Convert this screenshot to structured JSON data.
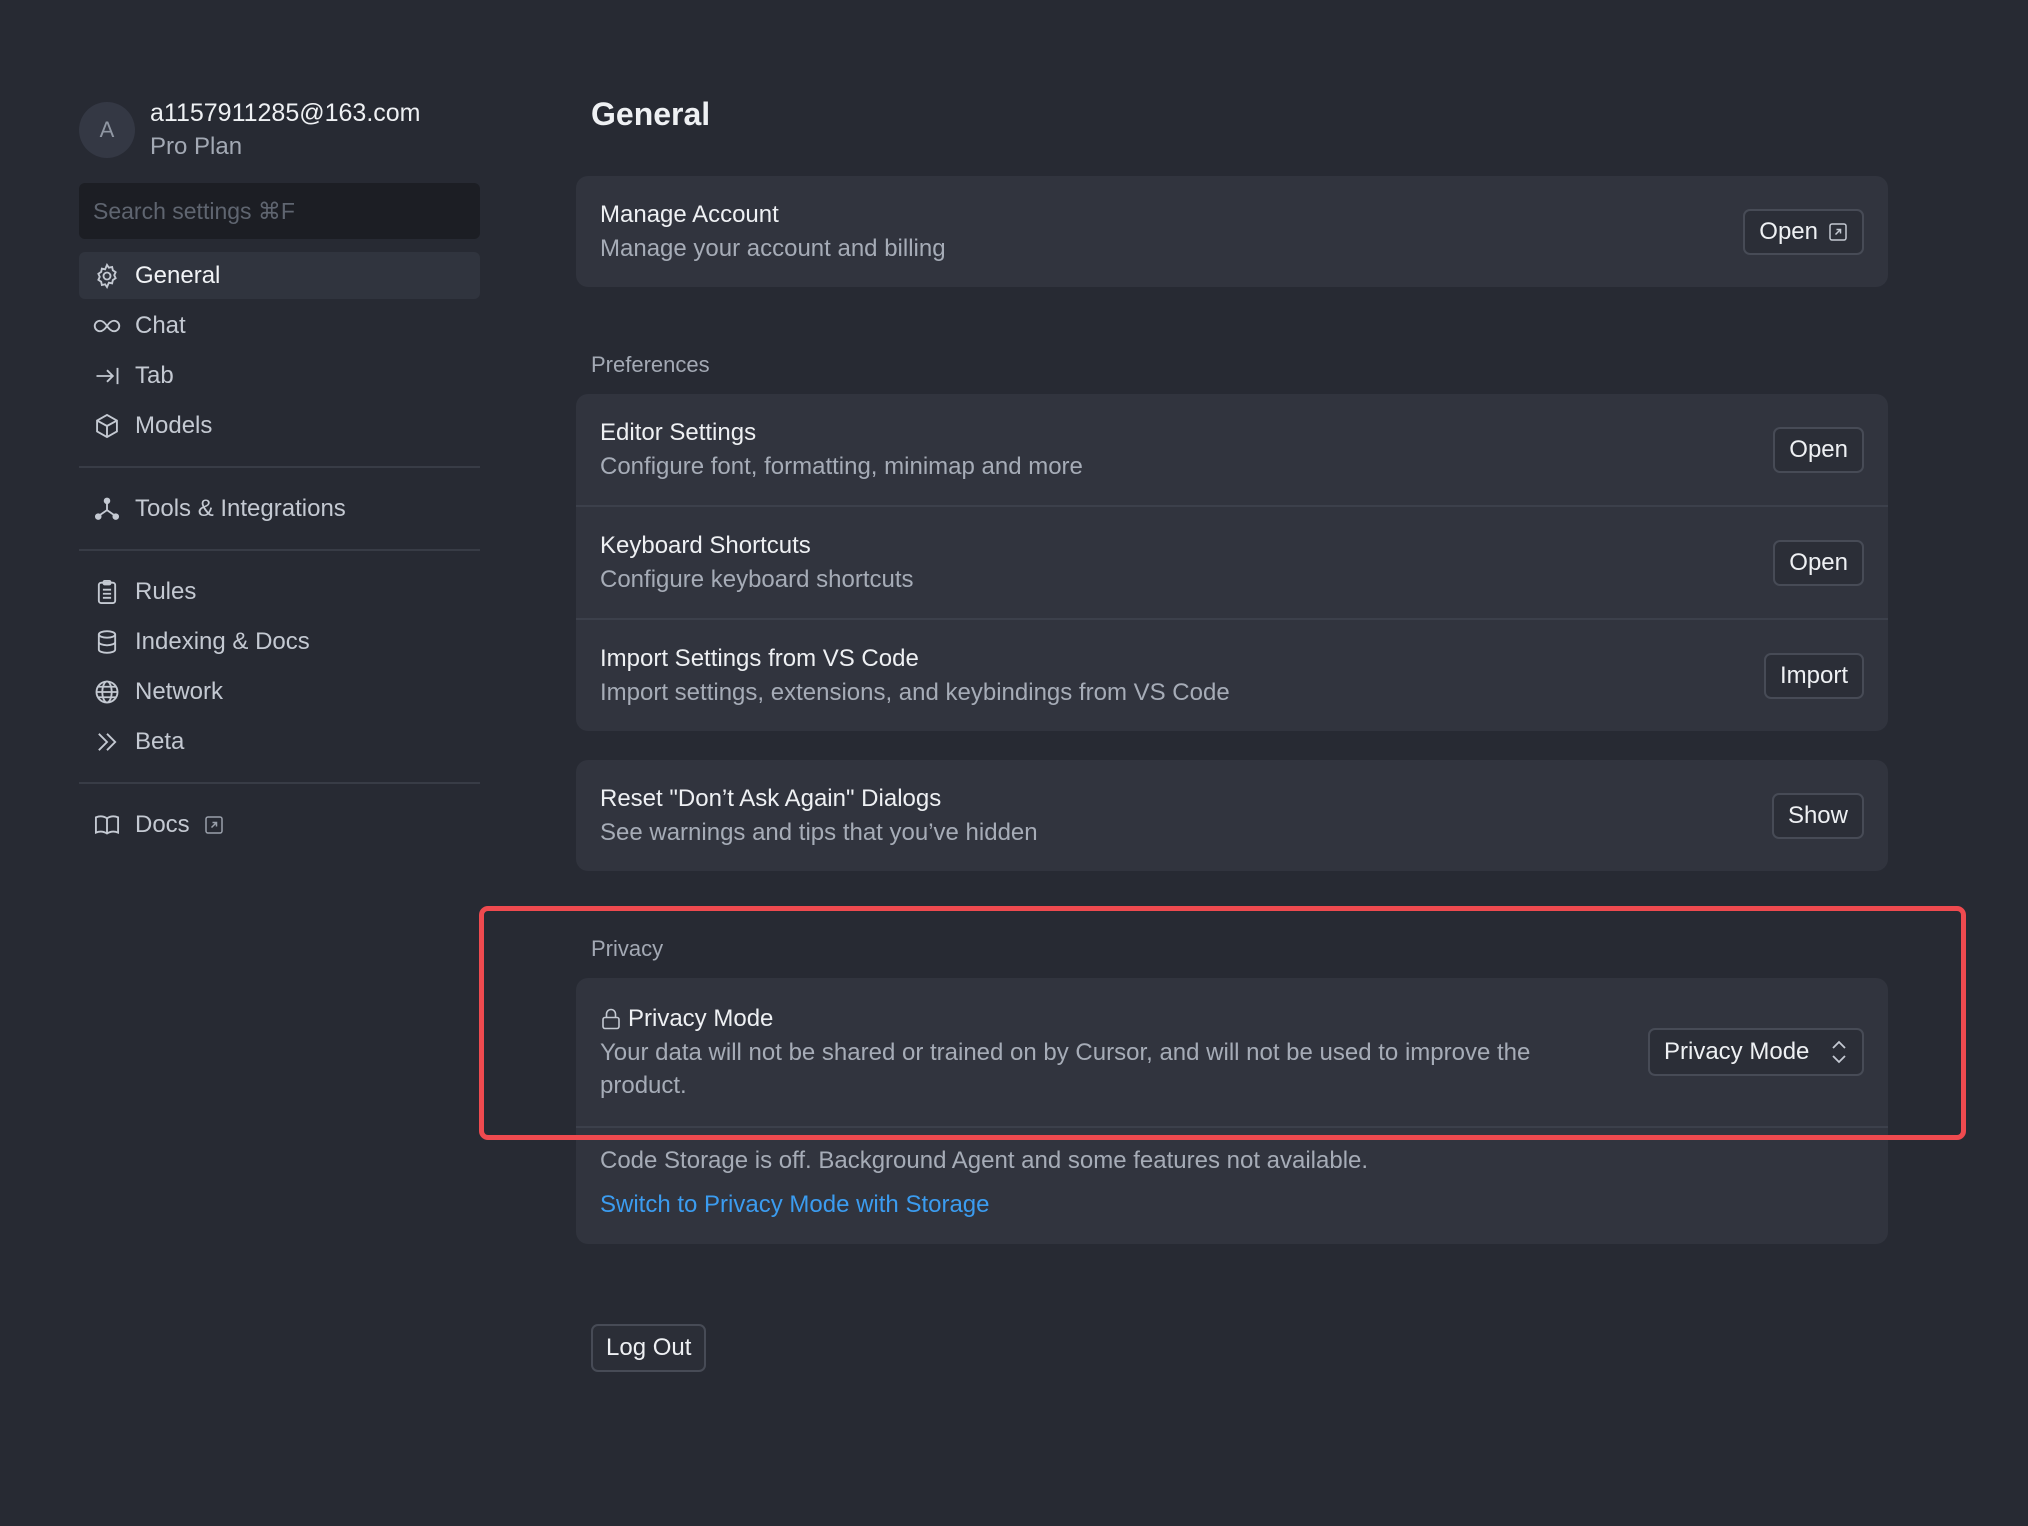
{
  "user": {
    "avatar_letter": "A",
    "email": "a1157911285@163.com",
    "plan": "Pro Plan"
  },
  "search": {
    "placeholder": "Search settings ⌘F"
  },
  "sidebar": {
    "groups": [
      [
        {
          "label": "General",
          "icon": "gear-icon",
          "active": true
        },
        {
          "label": "Chat",
          "icon": "infinity-icon"
        },
        {
          "label": "Tab",
          "icon": "arrow-right-bar-icon"
        },
        {
          "label": "Models",
          "icon": "cube-icon"
        }
      ],
      [
        {
          "label": "Tools & Integrations",
          "icon": "nodes-icon"
        }
      ],
      [
        {
          "label": "Rules",
          "icon": "clipboard-icon"
        },
        {
          "label": "Indexing & Docs",
          "icon": "database-icon"
        },
        {
          "label": "Network",
          "icon": "globe-icon"
        },
        {
          "label": "Beta",
          "icon": "double-chevron-icon"
        }
      ],
      [
        {
          "label": "Docs",
          "icon": "book-icon",
          "external": true
        }
      ]
    ]
  },
  "main": {
    "title": "General",
    "account": {
      "title": "Manage Account",
      "desc": "Manage your account and billing",
      "button": "Open"
    },
    "preferences": {
      "label": "Preferences",
      "rows": [
        {
          "title": "Editor Settings",
          "desc": "Configure font, formatting, minimap and more",
          "button": "Open"
        },
        {
          "title": "Keyboard Shortcuts",
          "desc": "Configure keyboard shortcuts",
          "button": "Open"
        },
        {
          "title": "Import Settings from VS Code",
          "desc": "Import settings, extensions, and keybindings from VS Code",
          "button": "Import"
        }
      ]
    },
    "reset": {
      "title": "Reset \"Don’t Ask Again\" Dialogs",
      "desc": "See warnings and tips that you’ve hidden",
      "button": "Show"
    },
    "privacy": {
      "label": "Privacy",
      "title": "Privacy Mode",
      "desc_line1": "Your data will not be shared or trained on by Cursor, and will not be used to improve the",
      "desc_line2": "product.",
      "select_value": "Privacy Mode",
      "storage_note": "Code Storage is off. Background Agent and some features not available.",
      "storage_link": "Switch to Privacy Mode with Storage"
    },
    "logout": "Log Out"
  },
  "colors": {
    "background": "#272a33",
    "card": "#31343e",
    "link": "#3b9cf0",
    "highlight": "#ef4a4f"
  }
}
